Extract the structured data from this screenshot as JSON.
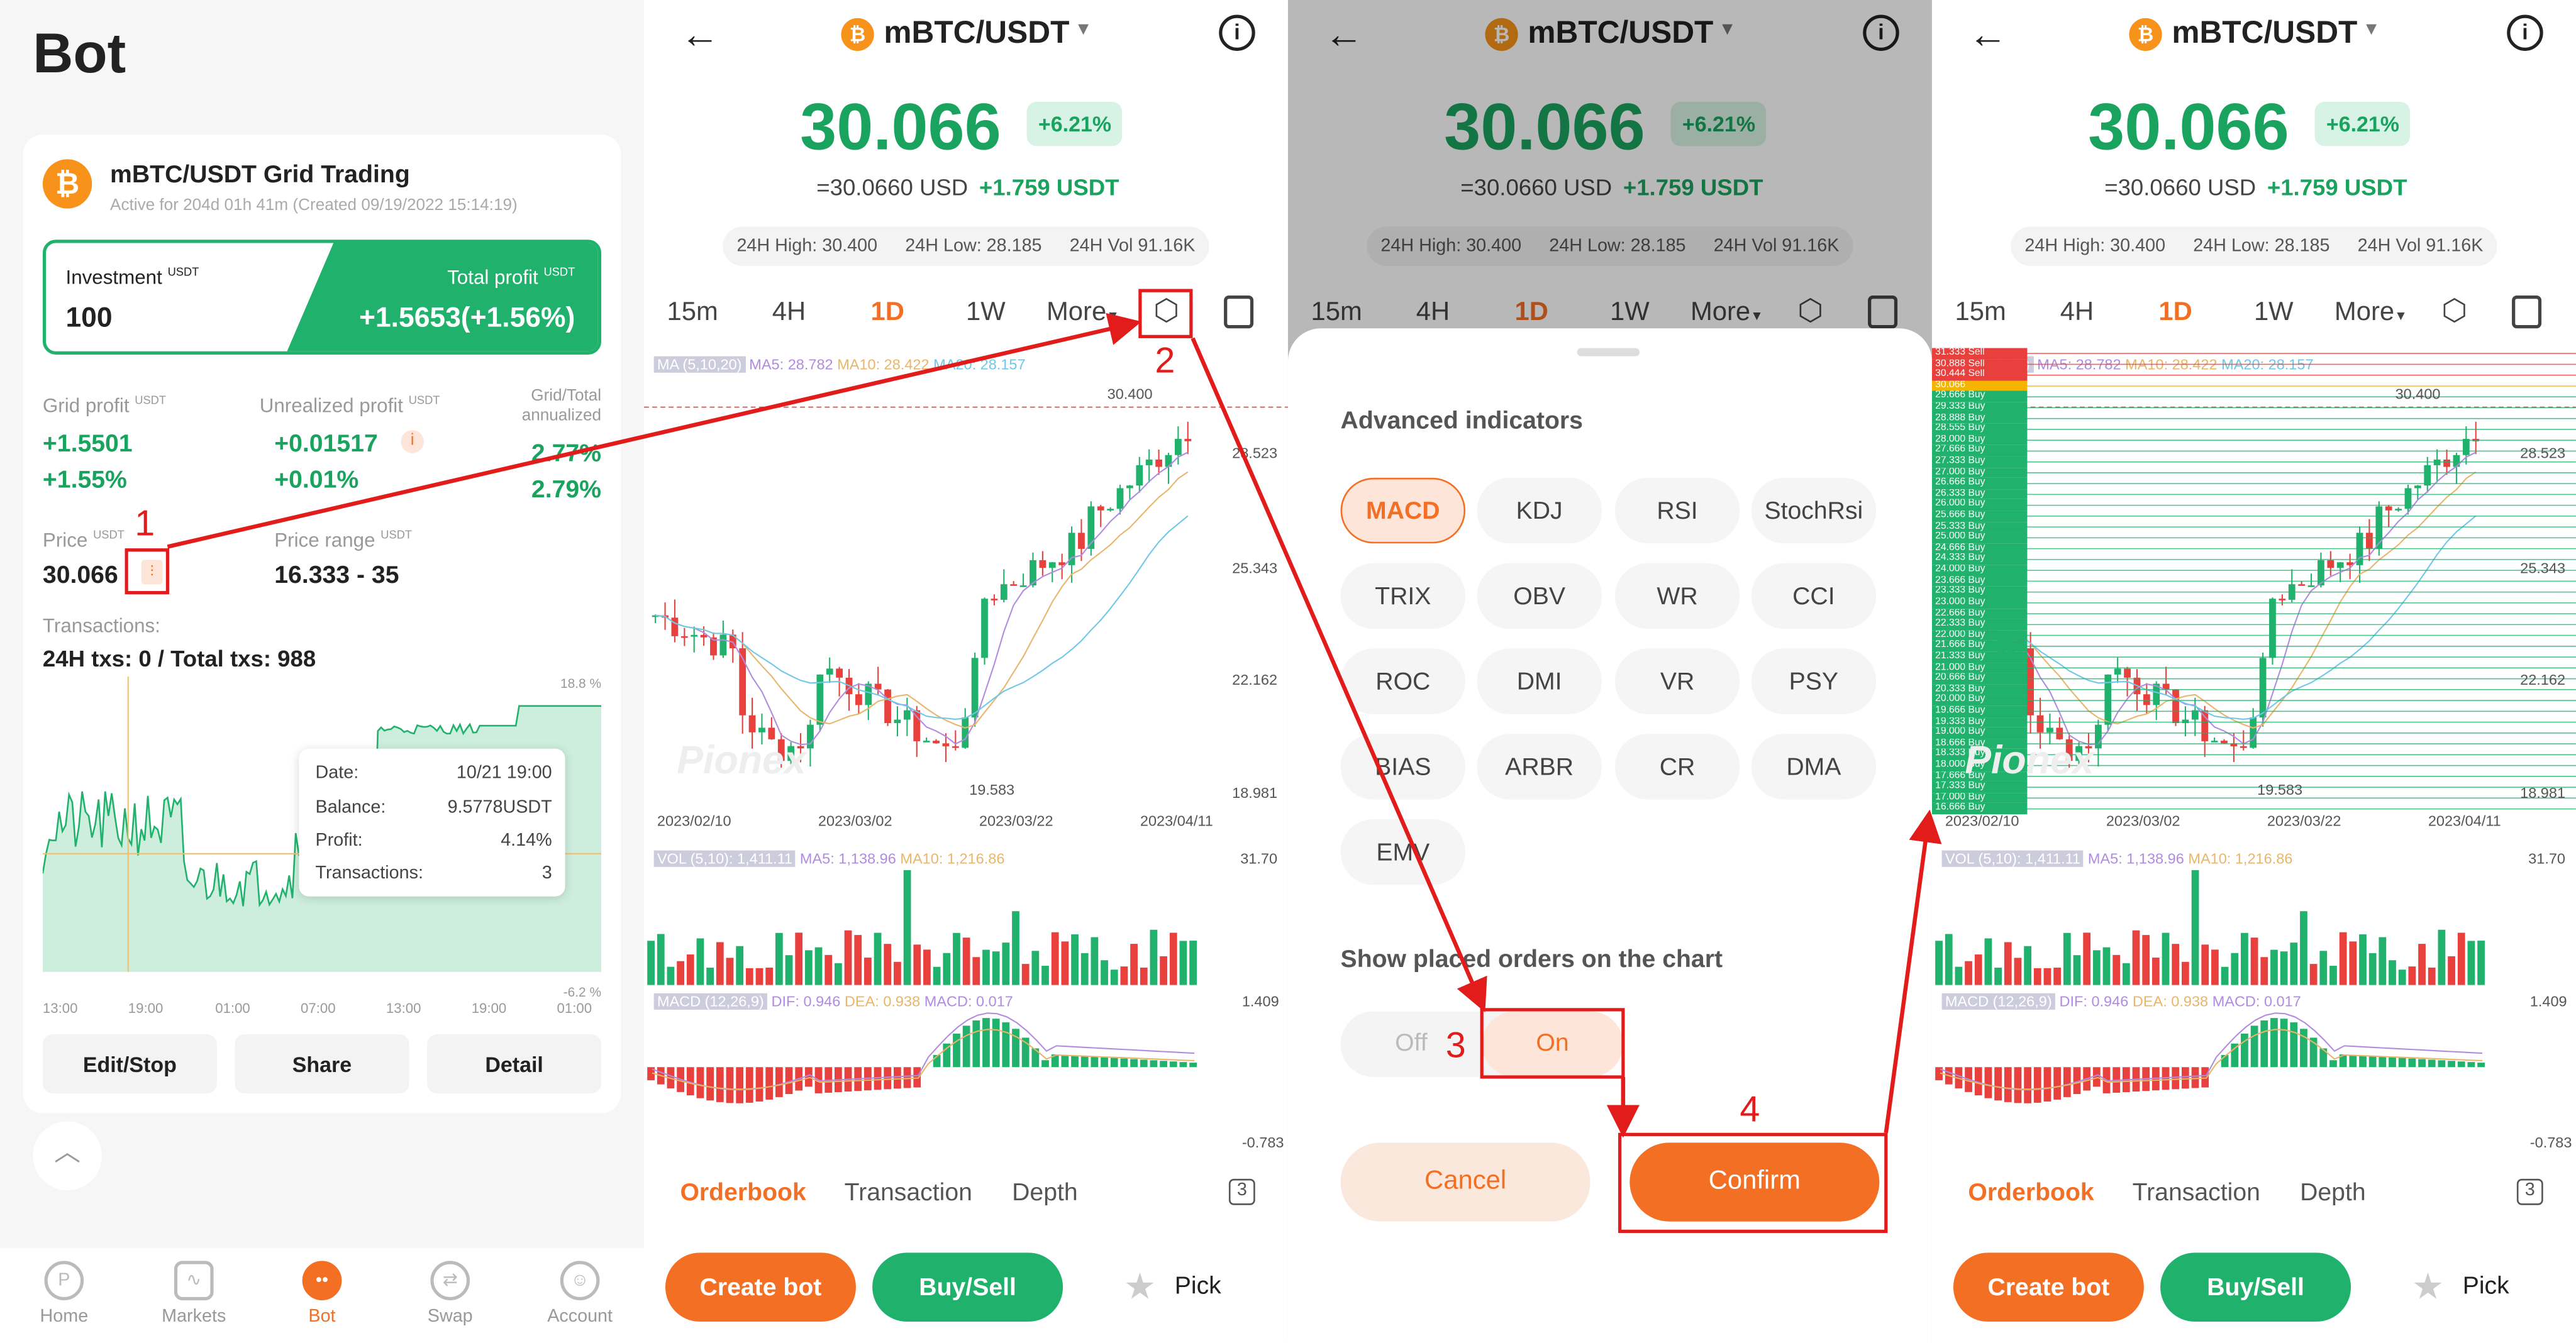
{
  "bot_page": {
    "title": "Bot",
    "card": {
      "pair_title": "mBTC/USDT Grid Trading",
      "active_text": "Active for 204d 01h 41m (Created 09/19/2022 15:14:19)",
      "investment_label": "Investment",
      "investment_unit": "USDT",
      "investment_value": "100",
      "total_profit_label": "Total profit",
      "total_profit_unit": "USDT",
      "total_profit_value": "+1.5653(+1.56%)",
      "grid_profit_label": "Grid profit",
      "grid_profit_unit": "USDT",
      "grid_profit_value": "+1.5501",
      "grid_profit_pct": "+1.55%",
      "unrealized_label": "Unrealized profit",
      "unrealized_unit": "USDT",
      "unrealized_value": "+0.01517",
      "unrealized_pct": "+0.01%",
      "annualized_label_1": "Grid/Total",
      "annualized_label_2": "annualized",
      "annualized_grid": "2.77%",
      "annualized_total": "2.79%",
      "price_label": "Price",
      "price_unit": "USDT",
      "price_value": "30.066",
      "range_label": "Price range",
      "range_unit": "USDT",
      "range_value": "16.333 - 35",
      "tx_label": "Transactions:",
      "tx_value": "24H txs: 0 / Total txs: 988",
      "chart_top_label": "18.8 %",
      "chart_bottom_label": "-6.2 %",
      "time_ticks": [
        "13:00",
        "19:00",
        "01:00",
        "07:00",
        "13:00",
        "19:00",
        "01:00"
      ],
      "tooltip": {
        "date_label": "Date:",
        "date_value": "10/21 19:00",
        "balance_label": "Balance:",
        "balance_value": "9.5778USDT",
        "profit_label": "Profit:",
        "profit_value": "4.14%",
        "tx_label": "Transactions:",
        "tx_value": "3"
      },
      "edit_button": "Edit/Stop",
      "share_button": "Share",
      "detail_button": "Detail"
    },
    "nav": [
      "Home",
      "Markets",
      "Bot",
      "Swap",
      "Account"
    ]
  },
  "market": {
    "pair": "mBTC/USDT",
    "price": "30.066",
    "change_pct": "+6.21%",
    "usd_value": "=30.0660 USD",
    "change_abs": "+1.759 USDT",
    "high": "24H High: 30.400",
    "low": "24H Low: 28.185",
    "vol": "24H Vol 91.16K",
    "timeframes": [
      "15m",
      "4H",
      "1D",
      "1W",
      "More"
    ],
    "selected_timeframe": "1D",
    "ma_label": "MA (5,10,20)",
    "ma5": "MA5: 28.782",
    "ma10": "MA10: 28.422",
    "ma20": "MA20: 28.157",
    "price_axis": [
      "28.523",
      "25.343",
      "22.162",
      "18.981"
    ],
    "high_marker": "30.400",
    "low_marker": "19.583",
    "dates": [
      "2023/02/10",
      "2023/03/02",
      "2023/03/22",
      "2023/04/11"
    ],
    "vol_label": "VOL (5,10): 1,411.11",
    "vol_ma5": "MA5: 1,138.96",
    "vol_ma10": "MA10: 1,216.86",
    "vol_axis": "31.70",
    "macd_label": "MACD (12,26,9)",
    "dif": "DIF: 0.946",
    "dea": "DEA: 0.938",
    "macd": "MACD: 0.017",
    "macd_axis_top": "1.409",
    "macd_axis_bottom": "-0.783",
    "tabs": [
      "Orderbook",
      "Transaction",
      "Depth"
    ],
    "tab_count": "3",
    "create_bot": "Create bot",
    "buy_sell": "Buy/Sell",
    "pick": "Pick",
    "watermark": "Pionex",
    "grid_orders": [
      "31.333 Sell",
      "30.888 Sell",
      "30.444 Sell",
      "30.066",
      "29.666 Buy",
      "29.333 Buy",
      "28.888 Buy",
      "28.555 Buy",
      "28.000 Buy",
      "27.666 Buy",
      "27.333 Buy",
      "27.000 Buy",
      "26.666 Buy",
      "26.333 Buy",
      "26.000 Buy",
      "25.666 Buy",
      "25.333 Buy",
      "25.000 Buy",
      "24.666 Buy",
      "24.333 Buy",
      "24.000 Buy",
      "23.666 Buy",
      "23.333 Buy",
      "23.000 Buy",
      "22.666 Buy",
      "22.333 Buy",
      "22.000 Buy",
      "21.666 Buy",
      "21.333 Buy",
      "21.000 Buy",
      "20.666 Buy",
      "20.333 Buy",
      "20.000 Buy",
      "19.666 Buy",
      "19.333 Buy",
      "19.000 Buy",
      "18.666 Buy",
      "18.333 Buy",
      "18.000 Buy",
      "17.666 Buy",
      "17.333 Buy",
      "17.000 Buy",
      "16.666 Buy"
    ]
  },
  "indicators_sheet": {
    "title": "Advanced indicators",
    "indicators": [
      "MACD",
      "KDJ",
      "RSI",
      "StochRsi",
      "TRIX",
      "OBV",
      "WR",
      "CCI",
      "ROC",
      "DMI",
      "VR",
      "PSY",
      "BIAS",
      "ARBR",
      "CR",
      "DMA",
      "EMV"
    ],
    "selected": "MACD",
    "orders_title": "Show placed orders on the chart",
    "off": "Off",
    "on": "On",
    "cancel": "Cancel",
    "confirm": "Confirm"
  },
  "annotations": [
    "1",
    "2",
    "3",
    "4"
  ],
  "colors": {
    "green": "#20b26c",
    "red": "#e8403c",
    "orange": "#f36f24",
    "annotation": "#e21b1b"
  }
}
